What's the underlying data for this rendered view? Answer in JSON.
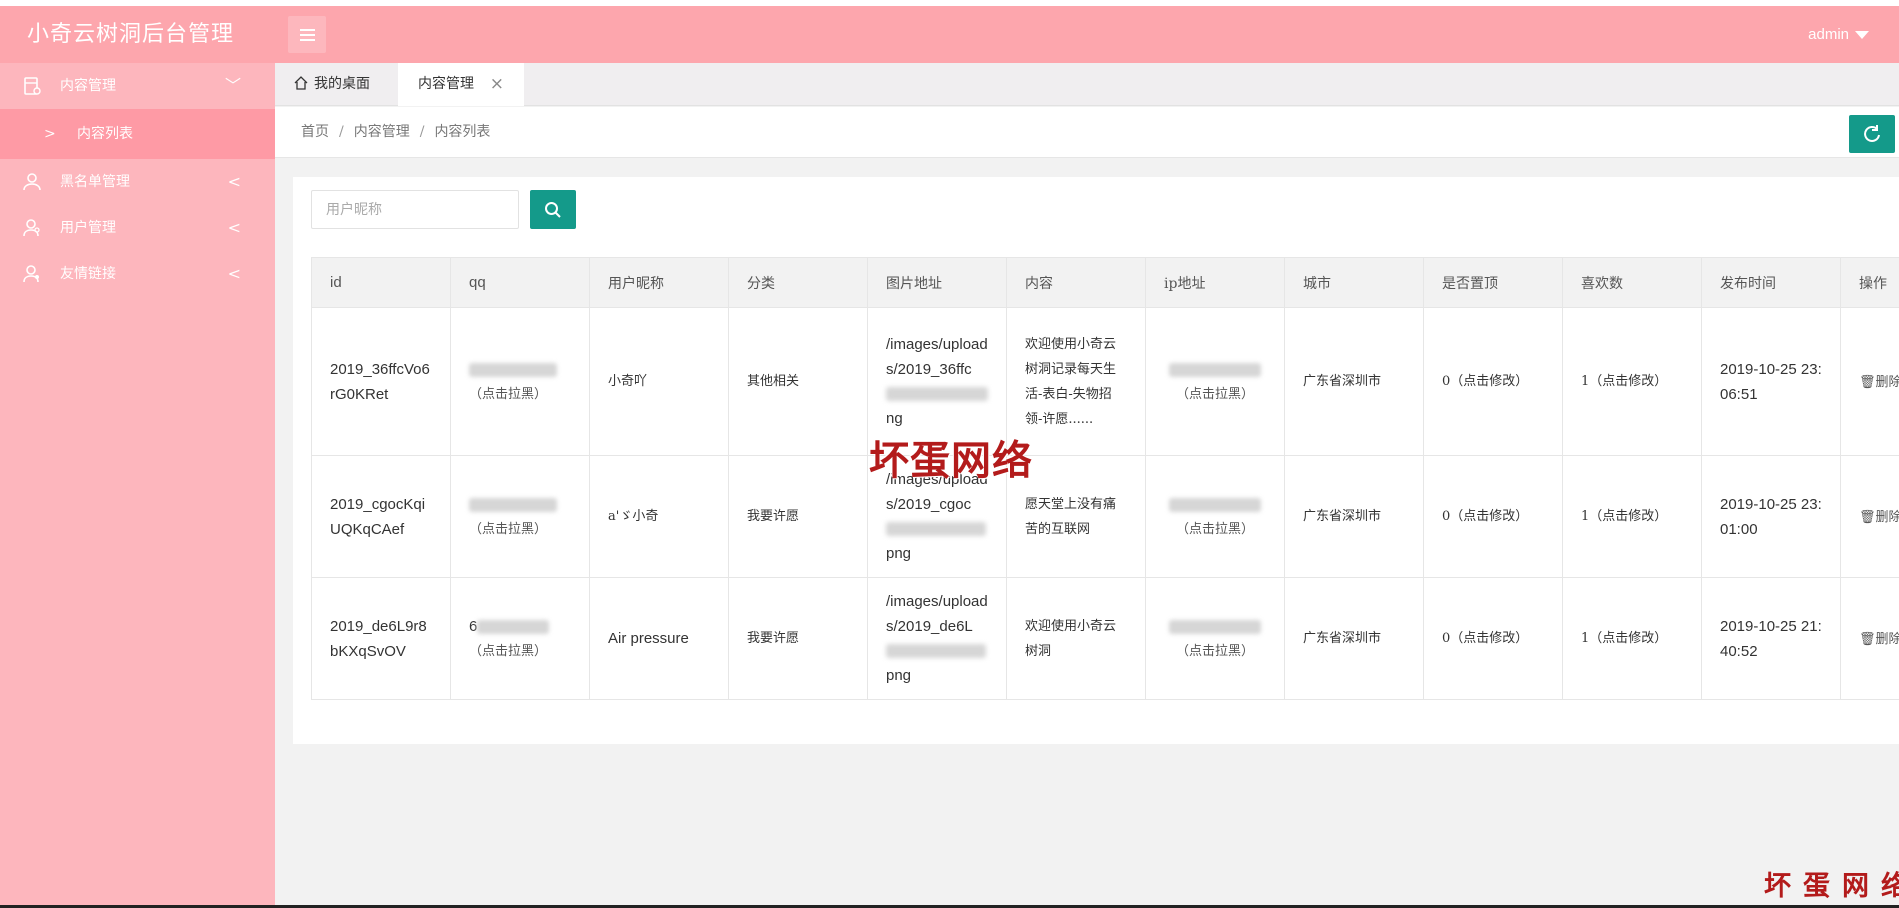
{
  "app": {
    "title": "小奇云树洞后台管理",
    "user": "admin"
  },
  "sidebar": {
    "items": [
      {
        "label": "内容管理",
        "icon": "content-icon",
        "expanded": true
      },
      {
        "label": "黑名单管理",
        "icon": "user-icon",
        "expanded": false
      },
      {
        "label": "用户管理",
        "icon": "users-icon",
        "expanded": false
      },
      {
        "label": "友情链接",
        "icon": "link-user-icon",
        "expanded": false
      }
    ],
    "subitem": {
      "label": "内容列表"
    }
  },
  "tabs": [
    {
      "label": "我的桌面",
      "icon": "home-icon"
    },
    {
      "label": "内容管理",
      "close": "×"
    }
  ],
  "breadcrumb": {
    "items": [
      "首页",
      "内容管理",
      "内容列表"
    ],
    "separator": "/"
  },
  "search": {
    "placeholder": "用户昵称"
  },
  "table": {
    "headers": [
      "id",
      "qq",
      "用户昵称",
      "分类",
      "图片地址",
      "内容",
      "ip地址",
      "城市",
      "是否置顶",
      "喜欢数",
      "发布时间",
      "操作"
    ],
    "rows": [
      {
        "id": "2019_36ffcVo6rG0KRet",
        "qq_note": "（点击拉黑）",
        "nickname": "小奇吖",
        "category": "其他相关",
        "image_start": "/images/uploads/2019_36ffc",
        "image_end": "ng",
        "content": "欢迎使用小奇云树洞记录每天生活-表白-失物招领-许愿......",
        "ip_note": "（点击拉黑）",
        "city": "广东省深圳市",
        "top": "0（点击修改）",
        "likes": "1（点击修改）",
        "time": "2019-10-25 23:06:51",
        "action": "删除"
      },
      {
        "id": "2019_cgocKqiUQKqCAef",
        "qq_note": "（点击拉黑）",
        "nickname": "a'ゞ小奇",
        "category": "我要许愿",
        "image_start": "/images/uploads/2019_cgoc",
        "image_end": "png",
        "content": "愿天堂上没有痛苦的互联网",
        "ip_note": "（点击拉黑）",
        "city": "广东省深圳市",
        "top": "0（点击修改）",
        "likes": "1（点击修改）",
        "time": "2019-10-25 23:01:00",
        "action": "删除"
      },
      {
        "id": "2019_de6L9r8bKXqSvOV",
        "qq_prefix": "6",
        "qq_note": "（点击拉黑）",
        "nickname": "Air pressure",
        "category": "我要许愿",
        "image_start": "/images/uploads/2019_de6L",
        "image_end": "png",
        "content": "欢迎使用小奇云树洞",
        "ip_note": "（点击拉黑）",
        "city": "广东省深圳市",
        "top": "0（点击修改）",
        "likes": "1（点击修改）",
        "time": "2019-10-25 21:40:52",
        "action": "删除"
      }
    ]
  },
  "watermarks": {
    "center": "坏蛋网络",
    "corner": "坏蛋网络"
  },
  "colors": {
    "header": "#fda6ad",
    "sidebar": "#fdb6bd",
    "sidebar_active": "#fe9aa5",
    "accent": "#149a8a"
  }
}
